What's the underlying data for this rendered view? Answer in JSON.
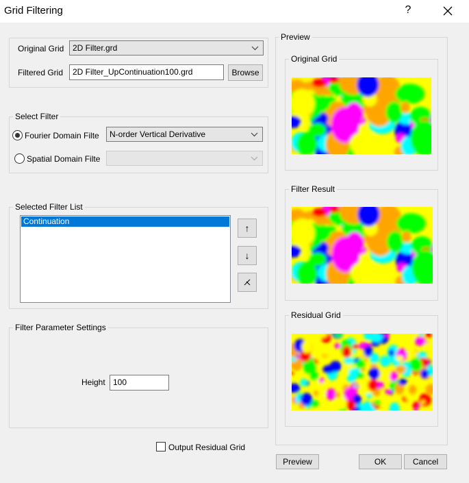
{
  "window": {
    "title": "Grid Filtering",
    "help_glyph": "?",
    "close_icon": "close-icon"
  },
  "grids": {
    "original_label": "Original Grid",
    "original_value": "2D Filter.grd",
    "filtered_label": "Filtered Grid",
    "filtered_value": "2D Filter_UpContinuation100.grd",
    "browse_label": "Browse"
  },
  "select_filter": {
    "legend": "Select Filter",
    "fourier_label": "Fourier Domain Filte",
    "fourier_value": "N-order Vertical Derivative",
    "fourier_checked": true,
    "spatial_label": "Spatial Domain Filte",
    "spatial_value": ""
  },
  "filter_list": {
    "legend": "Selected Filter List",
    "items": [
      "Continuation"
    ],
    "selected_index": 0,
    "up_glyph": "↑",
    "down_glyph": "↓",
    "delete_icon": "remove-filter-icon"
  },
  "params": {
    "legend": "Filter Parameter Settings",
    "height_label": "Height",
    "height_value": "100"
  },
  "residual": {
    "checkbox_label": "Output Residual Grid",
    "checked": false
  },
  "preview": {
    "legend": "Preview",
    "original_label": "Original Grid",
    "result_label": "Filter Result",
    "residual_label": "Residual Grid",
    "palette": [
      "#ff00ff",
      "#ff0000",
      "#ffa500",
      "#ffff00",
      "#00ff00",
      "#00ffff",
      "#0000ff"
    ]
  },
  "buttons": {
    "preview": "Preview",
    "ok": "OK",
    "cancel": "Cancel"
  }
}
